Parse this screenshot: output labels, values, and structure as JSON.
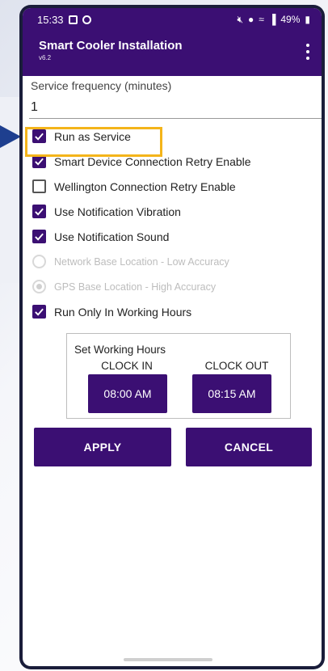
{
  "status_bar": {
    "time": "15:33",
    "battery": "49%",
    "icons": [
      "photo-icon",
      "location-app-icon",
      "mute-icon",
      "location-icon",
      "wifi-icon",
      "signal-icon",
      "battery-icon"
    ]
  },
  "app_bar": {
    "title": "Smart Cooler Installation",
    "version": "v6.2",
    "menu_icon": "more-vert-icon"
  },
  "service_frequency": {
    "label": "Service frequency (minutes)",
    "value": "1"
  },
  "options": [
    {
      "label": "Run as Service",
      "type": "checkbox",
      "checked": true,
      "enabled": true
    },
    {
      "label": "Smart Device Connection Retry Enable",
      "type": "checkbox",
      "checked": true,
      "enabled": true
    },
    {
      "label": "Wellington Connection Retry Enable",
      "type": "checkbox",
      "checked": false,
      "enabled": true
    },
    {
      "label": "Use Notification Vibration",
      "type": "checkbox",
      "checked": true,
      "enabled": true
    },
    {
      "label": "Use Notification Sound",
      "type": "checkbox",
      "checked": true,
      "enabled": true
    },
    {
      "label": "Network Base Location - Low Accuracy",
      "type": "radio",
      "checked": false,
      "enabled": false
    },
    {
      "label": "GPS Base Location - High Accuracy",
      "type": "radio",
      "checked": true,
      "enabled": false
    },
    {
      "label": "Run Only In Working Hours",
      "type": "checkbox",
      "checked": true,
      "enabled": true
    }
  ],
  "working_hours": {
    "title": "Set Working Hours",
    "clock_in_label": "CLOCK IN",
    "clock_in_value": "08:00 AM",
    "clock_out_label": "CLOCK OUT",
    "clock_out_value": "08:15 AM"
  },
  "actions": {
    "apply": "APPLY",
    "cancel": "CANCEL"
  },
  "colors": {
    "primary": "#3b0f73",
    "highlight": "#f4b41a",
    "pointer": "#1e3f8f"
  }
}
